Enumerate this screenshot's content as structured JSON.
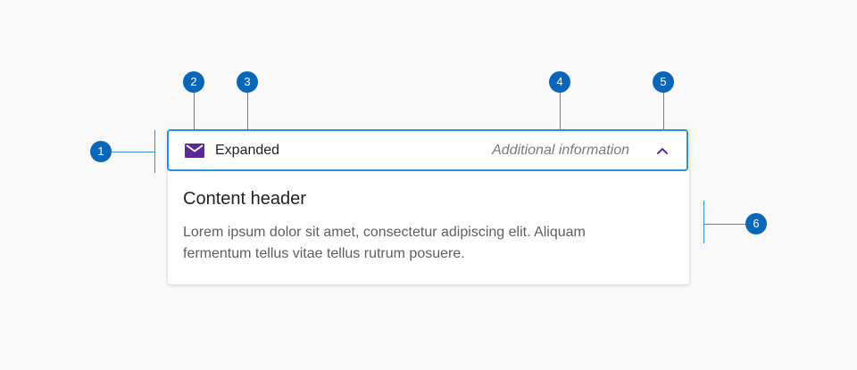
{
  "accordion": {
    "header_title": "Expanded",
    "header_info": "Additional information",
    "icon": "mail-icon",
    "toggle_icon": "chevron-up-icon",
    "content_header": "Content header",
    "content_body": "Lorem ipsum dolor sit amet, consectetur adipiscing elit. Aliquam fermentum tellus vitae tellus rutrum posuere."
  },
  "callouts": [
    "1",
    "2",
    "3",
    "4",
    "5",
    "6"
  ],
  "colors": {
    "accent_border": "#2b8fe0",
    "icon": "#5b2a91",
    "badge": "#0a66b7",
    "callout_line": "#3a8ad6"
  }
}
